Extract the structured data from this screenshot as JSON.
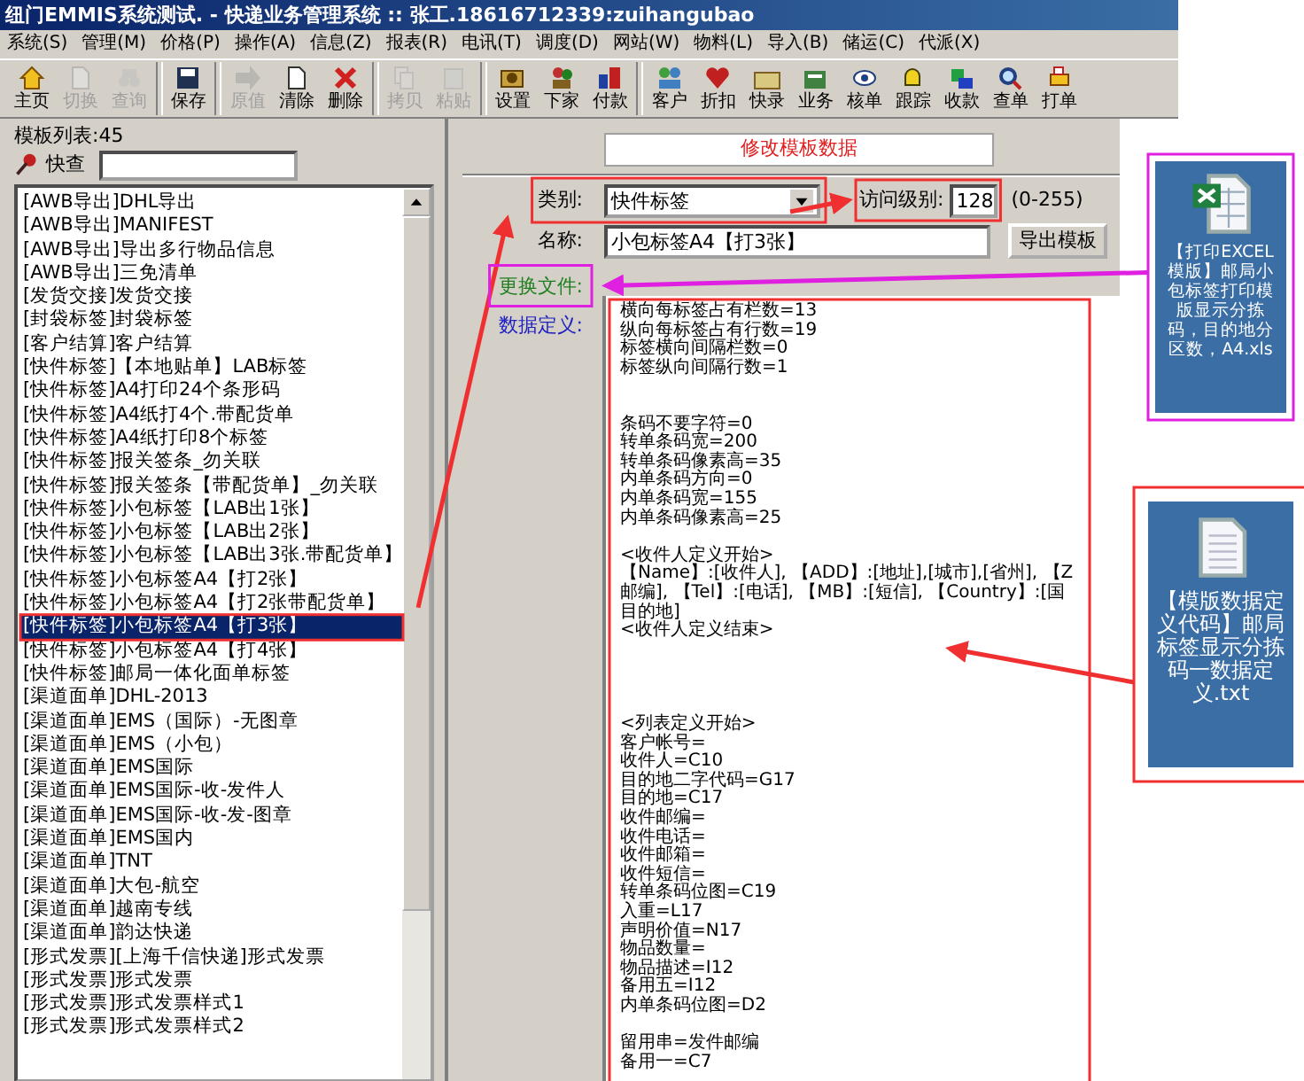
{
  "window": {
    "title": "纽门EMMIS系统测试. - 快递业务管理系统 :: 张工.18616712339:zuihangubao"
  },
  "menu": [
    "系统(S)",
    "管理(M)",
    "价格(P)",
    "操作(A)",
    "信息(Z)",
    "报表(R)",
    "电讯(T)",
    "调度(D)",
    "网站(W)",
    "物料(L)",
    "导入(B)",
    "储运(C)",
    "代派(X)"
  ],
  "toolbar": [
    {
      "label": "主页",
      "disabled": false,
      "group_start": false
    },
    {
      "label": "切换",
      "disabled": true,
      "group_start": false
    },
    {
      "label": "查询",
      "disabled": true,
      "group_start": false
    },
    {
      "label": "保存",
      "disabled": false,
      "group_start": true
    },
    {
      "label": "原值",
      "disabled": true,
      "group_start": true
    },
    {
      "label": "清除",
      "disabled": false,
      "group_start": false
    },
    {
      "label": "删除",
      "disabled": false,
      "group_start": false
    },
    {
      "label": "拷贝",
      "disabled": true,
      "group_start": true
    },
    {
      "label": "粘贴",
      "disabled": true,
      "group_start": false
    },
    {
      "label": "设置",
      "disabled": false,
      "group_start": true
    },
    {
      "label": "下家",
      "disabled": false,
      "group_start": false
    },
    {
      "label": "付款",
      "disabled": false,
      "group_start": false
    },
    {
      "label": "客户",
      "disabled": false,
      "group_start": true
    },
    {
      "label": "折扣",
      "disabled": false,
      "group_start": false
    },
    {
      "label": "快录",
      "disabled": false,
      "group_start": false
    },
    {
      "label": "业务",
      "disabled": false,
      "group_start": false
    },
    {
      "label": "核单",
      "disabled": false,
      "group_start": false
    },
    {
      "label": "跟踪",
      "disabled": false,
      "group_start": false
    },
    {
      "label": "收款",
      "disabled": false,
      "group_start": false
    },
    {
      "label": "查单",
      "disabled": false,
      "group_start": false
    },
    {
      "label": "打单",
      "disabled": false,
      "group_start": false
    }
  ],
  "template_list": {
    "title": "模板列表:45",
    "search_label": "快查",
    "items": [
      {
        "text": "[AWB导出]DHL导出",
        "selected": false
      },
      {
        "text": "[AWB导出]MANIFEST",
        "selected": false
      },
      {
        "text": "[AWB导出]导出多行物品信息",
        "selected": false
      },
      {
        "text": "[AWB导出]三免清单",
        "selected": false
      },
      {
        "text": "[发货交接]发货交接",
        "selected": false
      },
      {
        "text": "[封袋标签]封袋标签",
        "selected": false
      },
      {
        "text": "[客户结算]客户结算",
        "selected": false
      },
      {
        "text": "[快件标签]【本地贴单】LAB标签",
        "selected": false
      },
      {
        "text": "[快件标签]A4打印24个条形码",
        "selected": false
      },
      {
        "text": "[快件标签]A4纸打4个.带配货单",
        "selected": false
      },
      {
        "text": "[快件标签]A4纸打印8个标签",
        "selected": false
      },
      {
        "text": "[快件标签]报关签条_勿关联",
        "selected": false
      },
      {
        "text": "[快件标签]报关签条【带配货单】_勿关联",
        "selected": false
      },
      {
        "text": "[快件标签]小包标签【LAB出1张】",
        "selected": false
      },
      {
        "text": "[快件标签]小包标签【LAB出2张】",
        "selected": false
      },
      {
        "text": "[快件标签]小包标签【LAB出3张.带配货单】",
        "selected": false
      },
      {
        "text": "[快件标签]小包标签A4【打2张】",
        "selected": false
      },
      {
        "text": "[快件标签]小包标签A4【打2张带配货单】",
        "selected": false
      },
      {
        "text": "[快件标签]小包标签A4【打3张】",
        "selected": true
      },
      {
        "text": "[快件标签]小包标签A4【打4张】",
        "selected": false
      },
      {
        "text": "[快件标签]邮局一体化面单标签",
        "selected": false
      },
      {
        "text": "[渠道面单]DHL-2013",
        "selected": false
      },
      {
        "text": "[渠道面单]EMS（国际）-无图章",
        "selected": false
      },
      {
        "text": "[渠道面单]EMS（小包）",
        "selected": false
      },
      {
        "text": "[渠道面单]EMS国际",
        "selected": false
      },
      {
        "text": "[渠道面单]EMS国际-收-发件人",
        "selected": false
      },
      {
        "text": "[渠道面单]EMS国际-收-发-图章",
        "selected": false
      },
      {
        "text": "[渠道面单]EMS国内",
        "selected": false
      },
      {
        "text": "[渠道面单]TNT",
        "selected": false
      },
      {
        "text": "[渠道面单]大包-航空",
        "selected": false
      },
      {
        "text": "[渠道面单]越南专线",
        "selected": false
      },
      {
        "text": "[渠道面单]韵达快递",
        "selected": false
      },
      {
        "text": "[形式发票][上海千信快递]形式发票",
        "selected": false
      },
      {
        "text": "[形式发票]形式发票",
        "selected": false
      },
      {
        "text": "[形式发票]形式发票样式1",
        "selected": false
      },
      {
        "text": "[形式发票]形式发票样式2",
        "selected": false
      }
    ]
  },
  "editor": {
    "heading": "修改模板数据",
    "category": {
      "label": "类别:",
      "value": "快件标签"
    },
    "access_level": {
      "label": "访问级别:",
      "value": "128",
      "range": "(0-255)"
    },
    "name": {
      "label": "名称:",
      "value": "小包标签A4【打3张】"
    },
    "export_button": "导出模板",
    "replace_file_label": "更换文件:",
    "data_definition": {
      "label": "数据定义:",
      "lines": [
        {
          "kind": "text",
          "text": "横向每标签占有栏数=13"
        },
        {
          "kind": "text",
          "text": "纵向每标签占有行数=19"
        },
        {
          "kind": "text",
          "text": "标签横向间隔栏数=0"
        },
        {
          "kind": "text",
          "text": "标签纵向间隔行数=1"
        },
        {
          "kind": "blank"
        },
        {
          "kind": "blank"
        },
        {
          "kind": "text",
          "text": "条码不要字符=0"
        },
        {
          "kind": "text",
          "text": "转单条码宽=200"
        },
        {
          "kind": "text",
          "text": "转单条码像素高=35"
        },
        {
          "kind": "text",
          "text": "内单条码方向=0"
        },
        {
          "kind": "text",
          "text": "内单条码宽=155"
        },
        {
          "kind": "text",
          "text": "内单条码像素高=25"
        },
        {
          "kind": "blank"
        },
        {
          "kind": "text",
          "text": "<收件人定义开始>"
        },
        {
          "kind": "text",
          "text": "【Name】:[收件人], 【ADD】:[地址],[城市],[省州], 【Z"
        },
        {
          "kind": "text",
          "text": "邮编], 【Tel】:[电话], 【MB】:[短信], 【Country】:[国"
        },
        {
          "kind": "text",
          "text": "目的地]"
        },
        {
          "kind": "text",
          "text": "<收件人定义结束>"
        },
        {
          "kind": "blank"
        },
        {
          "kind": "blank"
        },
        {
          "kind": "blank"
        },
        {
          "kind": "blank"
        },
        {
          "kind": "text",
          "text": "<列表定义开始>"
        },
        {
          "kind": "text",
          "text": "客户帐号="
        },
        {
          "kind": "text",
          "text": "收件人=C10"
        },
        {
          "kind": "text",
          "text": "目的地二字代码=G17"
        },
        {
          "kind": "text",
          "text": "目的地=C17"
        },
        {
          "kind": "text",
          "text": "收件邮编="
        },
        {
          "kind": "text",
          "text": "收件电话="
        },
        {
          "kind": "text",
          "text": "收件邮箱="
        },
        {
          "kind": "text",
          "text": "收件短信="
        },
        {
          "kind": "text",
          "text": "转单条码位图=C19"
        },
        {
          "kind": "text",
          "text": "入重=L17"
        },
        {
          "kind": "text",
          "text": "声明价值=N17"
        },
        {
          "kind": "text",
          "text": "物品数量="
        },
        {
          "kind": "text",
          "text": "物品描述=I12"
        },
        {
          "kind": "text",
          "text": "备用五=I12"
        },
        {
          "kind": "text",
          "text": "内单条码位图=D2"
        },
        {
          "kind": "blank"
        },
        {
          "kind": "text",
          "text": "留用串=发件邮编"
        },
        {
          "kind": "text",
          "text": "备用一=C7"
        }
      ]
    }
  },
  "files": [
    {
      "kind": "spreadsheet",
      "name": "【打印EXCEL模版】邮局小包标签打印模版显示分拣码，目的地分区数，A4.xls"
    },
    {
      "kind": "text",
      "name": "【模版数据定义代码】邮局标签显示分拣码一数据定义.txt"
    }
  ]
}
